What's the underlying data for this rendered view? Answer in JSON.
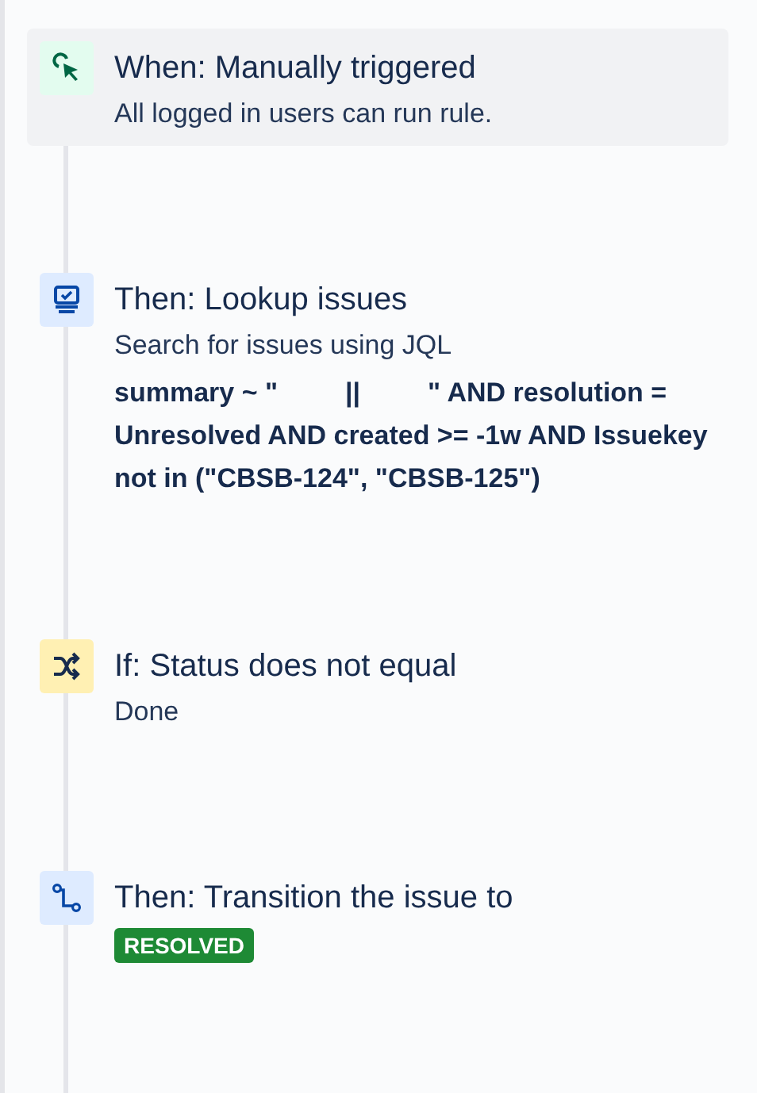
{
  "steps": [
    {
      "kind": "trigger",
      "selected": true,
      "title": "When: Manually triggered",
      "lines": [
        {
          "kind": "text",
          "text": "All logged in users can run rule."
        }
      ]
    },
    {
      "kind": "lookup",
      "selected": false,
      "title": "Then: Lookup issues",
      "lines": [
        {
          "kind": "text",
          "text": "Search for issues using JQL"
        },
        {
          "kind": "jql",
          "text": "summary ~ \"         ||         \" AND resolution = Unresolved AND created >= -1w AND Issuekey not in (\"CBSB-124\", \"CBSB-125\")"
        }
      ]
    },
    {
      "kind": "condition",
      "selected": false,
      "title": "If: Status does not equal",
      "lines": [
        {
          "kind": "text",
          "text": "Done"
        }
      ]
    },
    {
      "kind": "transition",
      "selected": false,
      "title": "Then: Transition the issue to",
      "lines": [
        {
          "kind": "lozenge",
          "text": "RESOLVED"
        }
      ]
    }
  ]
}
